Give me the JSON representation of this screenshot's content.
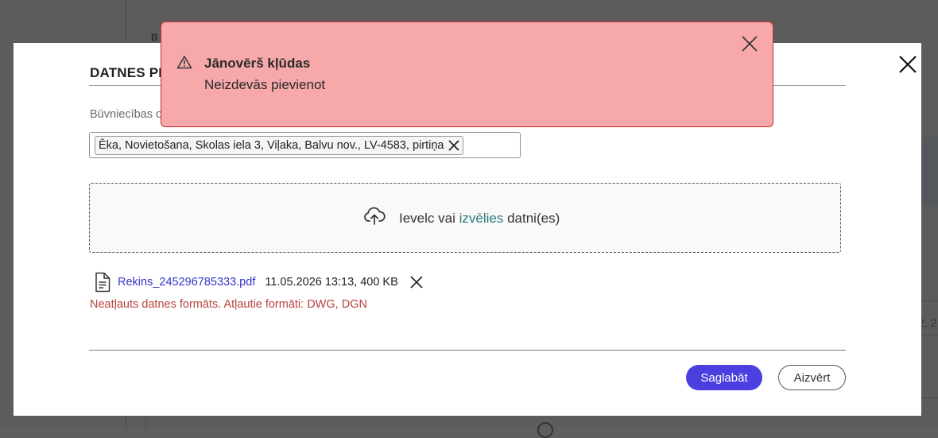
{
  "background": {
    "header_fragment": "B",
    "row_fragment": "2, 2"
  },
  "modal": {
    "title": "DATNES PI",
    "close_icon": "close-icon",
    "field_label": "Būvniecības o",
    "selected_object": "Ēka, Novietošana, Skolas iela 3, Viļaka, Balvu nov., LV-4583, pirtiņa",
    "dropzone": {
      "icon": "cloud-upload-icon",
      "text_before": "Ievelc vai",
      "link": "izvēlies",
      "text_after": "datni(es)"
    },
    "file": {
      "icon": "document-icon",
      "name": "Rekins_245296785333.pdf",
      "meta": "11.05.2026 13:13, 400 KB",
      "error": "Neatļauts datnes formāts. Atļautie formāti: DWG, DGN"
    },
    "buttons": {
      "save": "Saglabāt",
      "close": "Aizvērt"
    }
  },
  "toast": {
    "icon": "warning-icon",
    "title": "Jānovērš kļūdas",
    "message": "Neizdevās pievienot",
    "close_icon": "close-icon"
  },
  "colors": {
    "primary": "#4b3fe0",
    "link": "#3535c8",
    "accent_link": "#2c7a78",
    "error_text": "#b8423c",
    "toast_bg": "#f7a8aa",
    "toast_border": "#c42a36"
  }
}
